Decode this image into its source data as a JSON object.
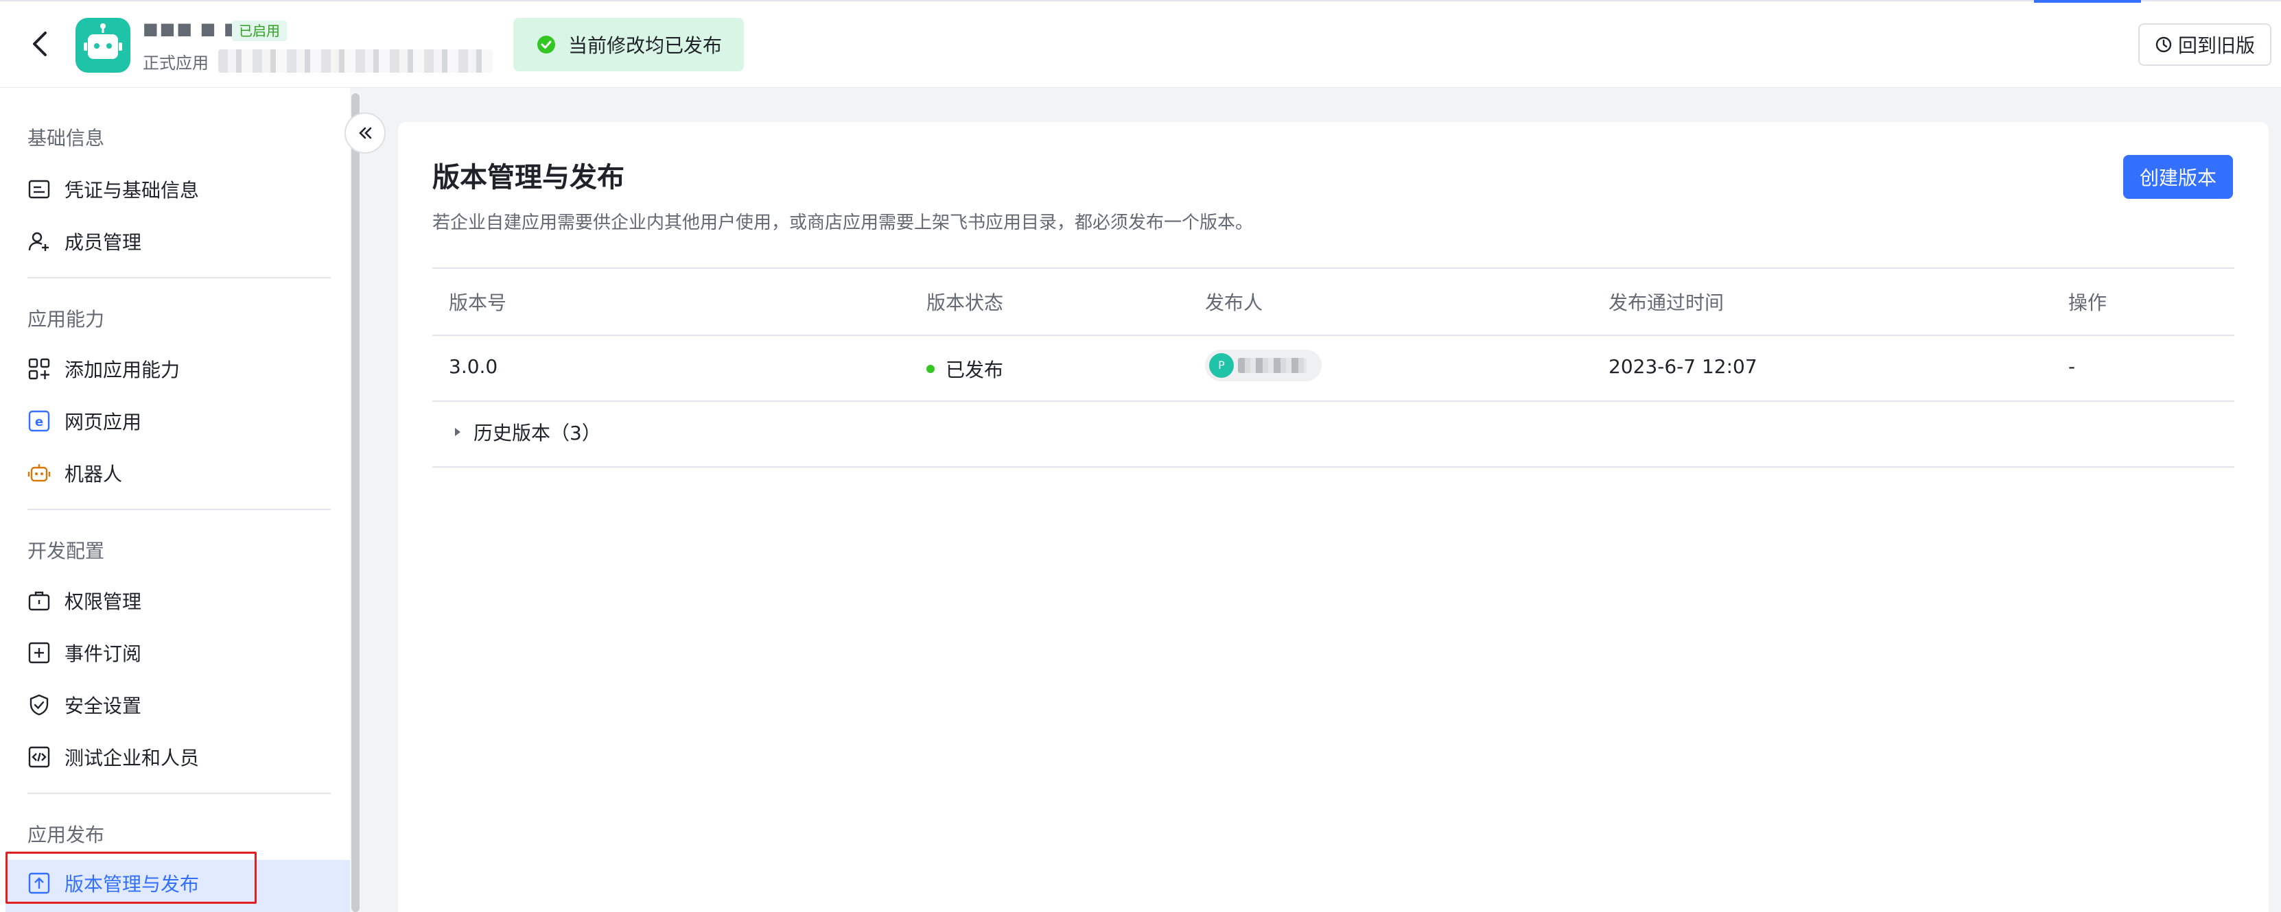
{
  "header": {
    "app_name": "■■■ ■ ■",
    "app_badge": "已启用",
    "app_subtitle": "正式应用",
    "toast": "当前修改均已发布",
    "restore_label": "回到旧版"
  },
  "sidebar": {
    "sections": [
      {
        "title": "基础信息",
        "items": [
          "凭证与基础信息",
          "成员管理"
        ]
      },
      {
        "title": "应用能力",
        "items": [
          "添加应用能力",
          "网页应用",
          "机器人"
        ]
      },
      {
        "title": "开发配置",
        "items": [
          "权限管理",
          "事件订阅",
          "安全设置",
          "测试企业和人员"
        ]
      },
      {
        "title": "应用发布",
        "items": [
          "版本管理与发布"
        ]
      }
    ],
    "active_item": "版本管理与发布"
  },
  "main": {
    "title": "版本管理与发布",
    "description": "若企业自建应用需要供企业内其他用户使用，或商店应用需要上架飞书应用目录，都必须发布一个版本。",
    "create_button": "创建版本",
    "table": {
      "headers": [
        "版本号",
        "版本状态",
        "发布人",
        "发布通过时间",
        "操作"
      ],
      "rows": [
        {
          "version": "3.0.0",
          "status": "已发布",
          "publisher_initial": "P",
          "time": "2023-6-7 12:07",
          "action": "-"
        }
      ],
      "history": "历史版本（3）"
    }
  },
  "colors": {
    "accent": "#3370ff",
    "success": "#34c724",
    "brand": "#1fc3a7",
    "highlight_box": "#e02020"
  }
}
